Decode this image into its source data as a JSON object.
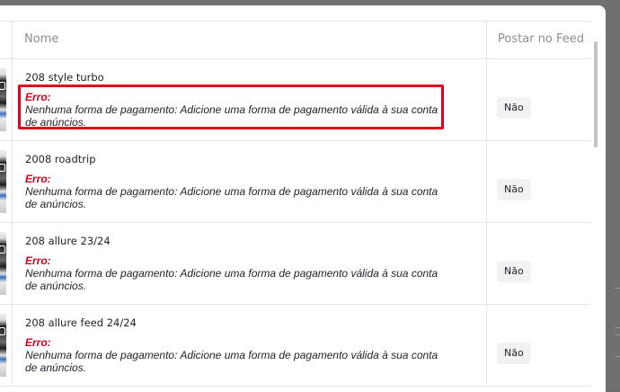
{
  "table": {
    "headers": {
      "name": "Nome",
      "post": "Postar no Feed"
    },
    "rows": [
      {
        "name": "208 style turbo",
        "error_label": "Erro:",
        "error_message": "Nenhuma forma de pagamento: Adicione uma forma de pagamento válida à sua conta de anúncios.",
        "post_value": "Não",
        "highlighted": true
      },
      {
        "name": "2008 roadtrip",
        "error_label": "Erro:",
        "error_message": "Nenhuma forma de pagamento: Adicione uma forma de pagamento válida à sua conta de anúncios.",
        "post_value": "Não",
        "highlighted": false
      },
      {
        "name": "208 allure 23/24",
        "error_label": "Erro:",
        "error_message": "Nenhuma forma de pagamento: Adicione uma forma de pagamento válida à sua conta de anúncios.",
        "post_value": "Não",
        "highlighted": false
      },
      {
        "name": "208 allure feed 24/24",
        "error_label": "Erro:",
        "error_message": "Nenhuma forma de pagamento: Adicione uma forma de pagamento válida à sua conta de anúncios.",
        "post_value": "Não",
        "highlighted": false
      }
    ]
  },
  "colors": {
    "error_red": "#d0021b",
    "highlight_border": "#e3001b",
    "header_text": "#8a8f96"
  }
}
